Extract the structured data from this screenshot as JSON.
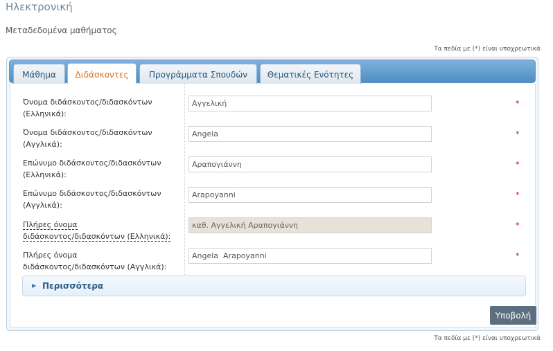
{
  "page": {
    "title": "Ηλεκτρονική",
    "subtitle": "Μεταδεδομένα μαθήματος",
    "required_note": "Τα πεδία με (*) είναι υποχρεωτικά"
  },
  "tabs": [
    {
      "label": "Μάθημα",
      "active": false
    },
    {
      "label": "Διδάσκοντες",
      "active": true
    },
    {
      "label": "Προγράμματα Σπουδών",
      "active": false
    },
    {
      "label": "Θεματικές Ενότητες",
      "active": false
    }
  ],
  "form": {
    "fields": [
      {
        "label_line1": "Όνομα διδάσκοντος/διδασκόντων",
        "label_line2": "(Ελληνικά):",
        "value": "Αγγελική",
        "required_mark": "*"
      },
      {
        "label_line1": "Όνομα διδάσκοντος/διδασκόντων",
        "label_line2": "(Αγγλικά):",
        "value": "Angela",
        "required_mark": "*"
      },
      {
        "label_line1": "Επώνυμο διδάσκοντος/διδασκόντων",
        "label_line2": "(Ελληνικά):",
        "value": "Αραπογιάννη",
        "required_mark": "*"
      },
      {
        "label_line1": "Επώνυμο διδάσκοντος/διδασκόντων",
        "label_line2": "(Αγγλικά):",
        "value": "Arapoyanni",
        "required_mark": "*"
      },
      {
        "label_line1": "Πλήρες όνομα",
        "label_line2": "διδάσκοντος/διδασκόντων (Ελληνικά):",
        "value": "καθ. Αγγελική Αραπογιάννη",
        "required_mark": "*",
        "readonly": true
      },
      {
        "label_line1": "Πλήρες όνομα",
        "label_line2": "διδάσκοντος/διδασκόντων (Αγγλικά):",
        "value": "Angela  Arapoyanni",
        "required_mark": "*"
      }
    ],
    "more_label": "Περισσότερα",
    "submit_label": "Υποβολή"
  }
}
